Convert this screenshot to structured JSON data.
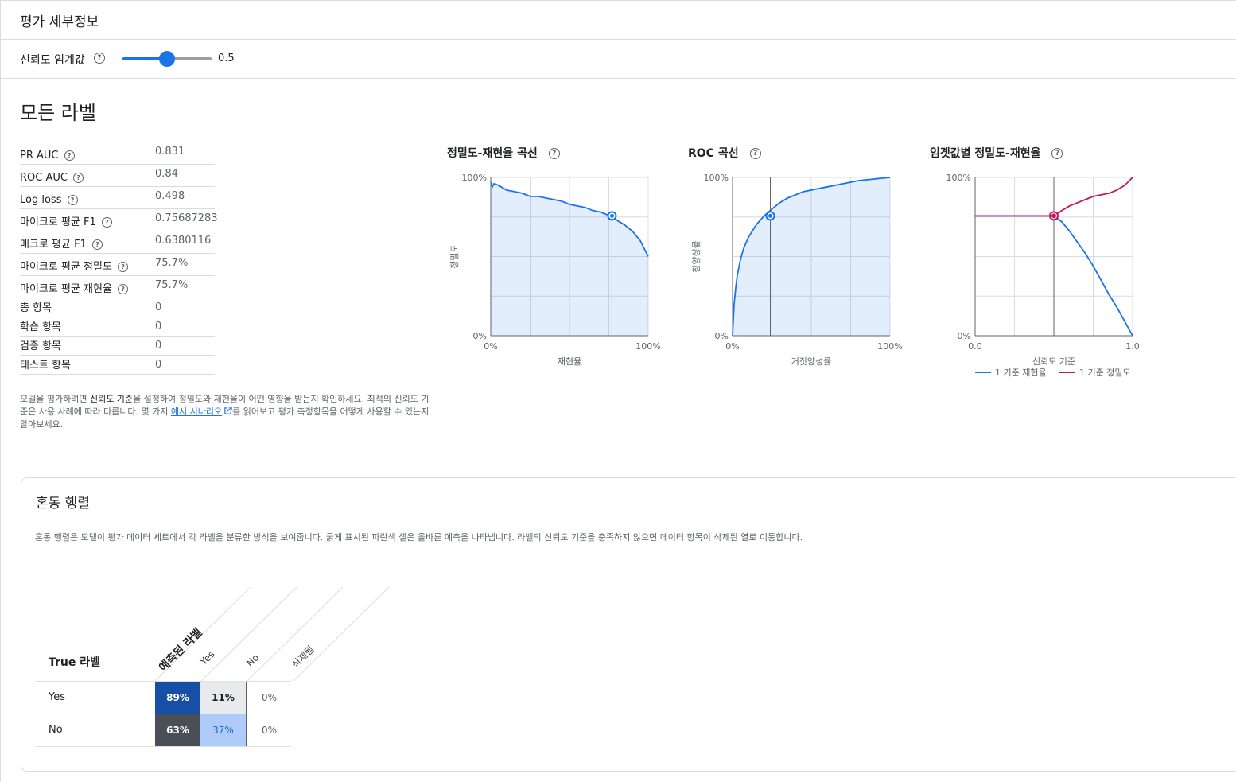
{
  "header": {
    "title": "평가 세부정보"
  },
  "threshold": {
    "label": "신뢰도 임계값",
    "help_icon": "help-circle-icon",
    "value": "0.5",
    "fraction": 0.5
  },
  "summary": {
    "title": "모든 라벨",
    "metrics": [
      {
        "label": "PR AUC",
        "value": "0.831",
        "help": true
      },
      {
        "label": "ROC AUC",
        "value": "0.84",
        "help": true
      },
      {
        "label": "Log loss",
        "value": "0.498",
        "help": true
      },
      {
        "label": "마이크로 평균 F1",
        "value": "0.75687283",
        "help": true
      },
      {
        "label": "매크로 평균 F1",
        "value": "0.6380116",
        "help": true
      },
      {
        "label": "마이크로 평균 정밀도",
        "value": "75.7%",
        "help": true
      },
      {
        "label": "마이크로 평균 재현율",
        "value": "75.7%",
        "help": true
      },
      {
        "label": "총 항목",
        "value": "0",
        "help": false
      },
      {
        "label": "학습 항목",
        "value": "0",
        "help": false
      },
      {
        "label": "검증 항목",
        "value": "0",
        "help": false
      },
      {
        "label": "테스트 항목",
        "value": "0",
        "help": false
      }
    ],
    "description": {
      "part1": "모델을 평가하려면 ",
      "bold": "신뢰도 기준",
      "part2": "을 설정하여 정밀도와 재현율이 어떤 영향을 받는지 확인하세요. 최적의 신뢰도 기준은 사용 사례에 따라 다릅니다. 몇 가지 ",
      "link": "예시 시나리오",
      "part3": "를 읽어보고 평가 측정항목을 어떻게 사용할 수 있는지 알아보세요."
    }
  },
  "charts": {
    "pr": {
      "title": "정밀도-재현율 곡선"
    },
    "roc": {
      "title": "ROC 곡선"
    },
    "thr": {
      "title": "임곗값별 정밀도-재현율"
    }
  },
  "chart_data": [
    {
      "type": "area",
      "title": "정밀도-재현율 곡선",
      "xlabel": "재현율",
      "ylabel": "정밀도",
      "xlim": [
        0,
        100
      ],
      "ylim": [
        0,
        100
      ],
      "x_ticks": [
        "0%",
        "100%"
      ],
      "y_ticks": [
        "0%",
        "100%"
      ],
      "x": [
        0,
        1,
        2,
        5,
        10,
        15,
        20,
        25,
        30,
        35,
        40,
        45,
        50,
        55,
        60,
        65,
        70,
        75,
        77,
        80,
        85,
        90,
        95,
        100
      ],
      "y": [
        97,
        94,
        96,
        95,
        92,
        91,
        90,
        88,
        88,
        87,
        86,
        85,
        83,
        82,
        81,
        79,
        78,
        76,
        75.7,
        73,
        70,
        66,
        60,
        50
      ],
      "marker": {
        "x": 77,
        "y": 75.7
      },
      "grid": true
    },
    {
      "type": "area",
      "title": "ROC 곡선",
      "xlabel": "거짓양성률",
      "ylabel": "참양성률",
      "xlim": [
        0,
        100
      ],
      "ylim": [
        0,
        100
      ],
      "x_ticks": [
        "0%",
        "100%"
      ],
      "y_ticks": [
        "0%",
        "100%"
      ],
      "x": [
        0,
        0.5,
        1,
        2,
        3,
        5,
        7,
        10,
        15,
        20,
        25,
        30,
        35,
        40,
        45,
        50,
        60,
        70,
        80,
        90,
        100
      ],
      "y": [
        0,
        10,
        20,
        30,
        38,
        48,
        55,
        62,
        70,
        75.7,
        80,
        84,
        87,
        89,
        91,
        92,
        94,
        96,
        98,
        99,
        100
      ],
      "marker": {
        "x": 24,
        "y": 75.7
      },
      "grid": true
    },
    {
      "type": "line",
      "title": "임곗값별 정밀도-재현율",
      "xlabel": "신뢰도 기준",
      "xlim": [
        0,
        1
      ],
      "ylim": [
        0,
        100
      ],
      "x_ticks": [
        "0.0",
        "1.0"
      ],
      "y_ticks": [
        "0%",
        "100%"
      ],
      "x": [
        0,
        0.1,
        0.2,
        0.3,
        0.4,
        0.5,
        0.55,
        0.6,
        0.65,
        0.7,
        0.75,
        0.8,
        0.85,
        0.9,
        0.95,
        1.0
      ],
      "series": [
        {
          "name": "1 기준 재현율",
          "color": "#1a73e8",
          "values": [
            75.7,
            75.7,
            75.7,
            75.7,
            75.7,
            75.7,
            72,
            66,
            59,
            52,
            44,
            35,
            26,
            18,
            9,
            0
          ]
        },
        {
          "name": "1 기준 정밀도",
          "color": "#c2185b",
          "values": [
            75.7,
            75.7,
            75.7,
            75.7,
            75.7,
            75.7,
            79,
            82,
            84,
            86,
            88,
            89,
            90,
            92,
            95,
            100
          ]
        }
      ],
      "marker": {
        "x": 0.5,
        "y": 75.7
      },
      "legend": "bottom",
      "grid": true
    }
  ],
  "confusion": {
    "title": "혼동 행렬",
    "description": "혼동 행렬은 모델이 평가 데이터 세트에서 각 라벨을 분류한 방식을 보여줍니다. 굵게 표시된 파란색 셀은 올바른 예측을 나타냅니다. 라벨의 신뢰도 기준을 충족하지 않으면 데이터 항목이 삭제된 열로 이동합니다.",
    "true_header": "True 라벨",
    "pred_header": "예측된 라벨",
    "columns": [
      "Yes",
      "No",
      "삭제됨"
    ],
    "rows": [
      {
        "label": "Yes",
        "cells": [
          "89%",
          "11%",
          "0%"
        ]
      },
      {
        "label": "No",
        "cells": [
          "63%",
          "37%",
          "0%"
        ]
      }
    ],
    "colors": {
      "strong_blue": "#174ea6",
      "dark_gray": "#4a4f57",
      "light_gray": "#e8eaed",
      "light_blue": "#aecbfa",
      "blue_text": "#1967d2"
    }
  }
}
